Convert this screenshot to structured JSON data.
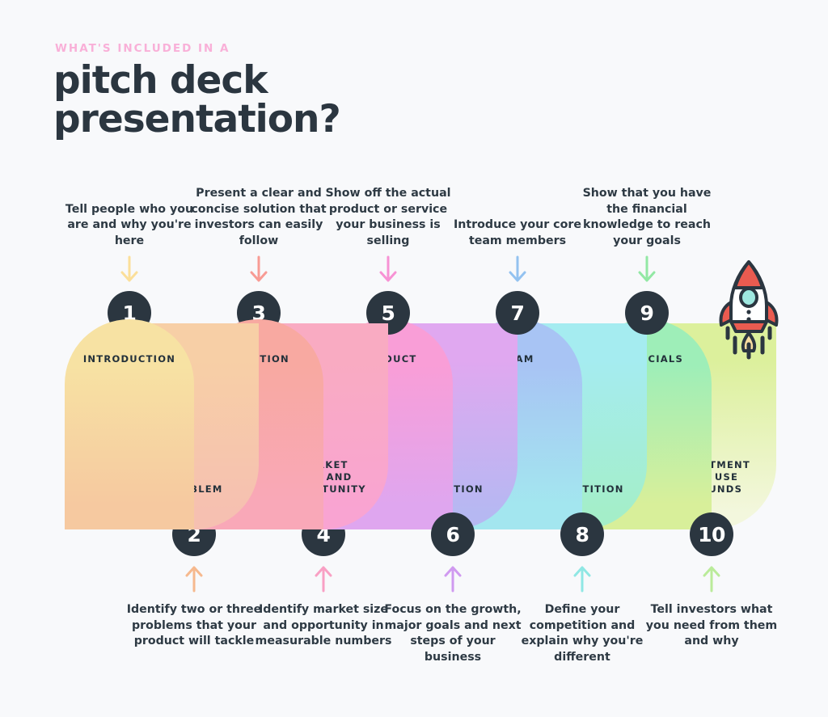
{
  "header": {
    "eyebrow": "WHAT'S INCLUDED IN A",
    "title_line1": "pitch deck",
    "title_line2": "presentation?"
  },
  "colors": {
    "background": "#f8f9fb",
    "ink": "#2b3640",
    "eyebrow_pink": "#f9b0d8",
    "badge": "#2b3640"
  },
  "icons": {
    "lightbulb": "lightbulb-icon",
    "rocket": "rocket-icon"
  },
  "steps": [
    {
      "number": "1",
      "label": "INTRODUCTION",
      "note": "Tell people who you are and why you're here",
      "position": "top",
      "color": "#f7e2a3",
      "color_next": "#f6c9a0",
      "arrow_color": "#fbdf9a"
    },
    {
      "number": "2",
      "label": "PROBLEM",
      "note": "Identify two or three problems that your product will tackle",
      "position": "bottom",
      "color": "#f7cfa6",
      "color_next": "#f6c0b1",
      "arrow_color": "#f6b98e"
    },
    {
      "number": "3",
      "label": "SOLUTION",
      "note": "Present a clear and concise solution that investors can easily follow",
      "position": "top",
      "color": "#f8a9a1",
      "color_next": "#f9a8b8",
      "arrow_color": "#f89b94"
    },
    {
      "number": "4",
      "label": "MARKET\nSIZE AND\nOPPORTUNITY",
      "note": "Identify market size and opportunity in measurable numbers",
      "position": "bottom",
      "color": "#f9abc2",
      "color_next": "#f9a4d2",
      "arrow_color": "#f9a0c4"
    },
    {
      "number": "5",
      "label": "PRODUCT",
      "note": "Show off the actual product or service your business is selling",
      "position": "top",
      "color": "#f99ed7",
      "color_next": "#dfa6ef",
      "arrow_color": "#f792d4"
    },
    {
      "number": "6",
      "label": "TRACTION",
      "note": "Focus on the growth, major goals and next steps of your business",
      "position": "bottom",
      "color": "#e0a8f0",
      "color_next": "#b6b8f2",
      "arrow_color": "#d09af0"
    },
    {
      "number": "7",
      "label": "TEAM",
      "note": "Introduce your core team members",
      "position": "top",
      "color": "#a8c4f4",
      "color_next": "#a3e6ef",
      "arrow_color": "#93c2f0"
    },
    {
      "number": "8",
      "label": "COMPETITION",
      "note": "Define your competition and explain why you're different",
      "position": "bottom",
      "color": "#a5ecf0",
      "color_next": "#a4eec9",
      "arrow_color": "#8fe7e4"
    },
    {
      "number": "9",
      "label": "FINANCIALS",
      "note": "Show that you have the financial knowledge to reach your goals",
      "position": "top",
      "color": "#9eeeb8",
      "color_next": "#d8ef9a",
      "arrow_color": "#92e8a4"
    },
    {
      "number": "10",
      "label": "INVESTMENT\nAND USE\nOF FUNDS",
      "note": "Tell investors what you need from them and why",
      "position": "bottom",
      "color": "#dcf09c",
      "color_next": "#f3f7dd",
      "arrow_color": "#baeb9a"
    }
  ]
}
